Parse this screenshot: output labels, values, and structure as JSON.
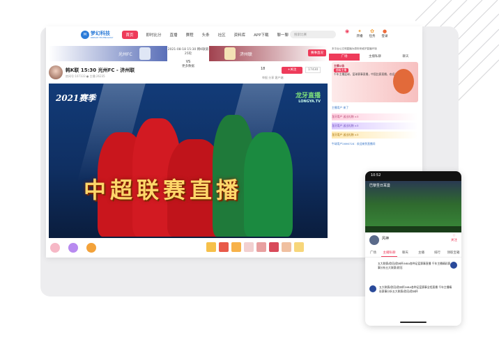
{
  "nav": {
    "logo_text": "梦幻科技",
    "logo_sub": "DREAM TECHNOLOGY",
    "items": [
      "首页",
      "即时比分",
      "直播",
      "赛程",
      "头条",
      "社区",
      "资料库",
      "APP下载",
      "聊一聊"
    ],
    "search_placeholder": "搜索比赛",
    "actions": [
      "开播",
      "任务",
      "登录"
    ]
  },
  "match": {
    "home": "光州FC",
    "away": "济州联",
    "time": "2021-08-18 15:30 韩K联第25轮",
    "more": "更多数据",
    "match_button": "赛事直况"
  },
  "room": {
    "title": "韩K联 15:30 光州FC - 济州联",
    "meta": "房间号:107333   ● 主播:26235",
    "heat": "18",
    "follow": "+关注",
    "fans": "17430",
    "actions": "举报  分享  客户端"
  },
  "video": {
    "season": "2021赛季",
    "brand": "龙牙直播",
    "brand_sub": "LONGYA.TV",
    "headline": "中超联赛直播"
  },
  "chat": {
    "warning": "本平台以文明直播为原则来维护直播环境",
    "tabs": [
      "广场",
      "主播私聊",
      "聊天"
    ],
    "notice_title": "主播公告",
    "notice_tag": "超级主播",
    "notice_text": "千年主播篮球，篮球赛事直播，中国比赛直播，欢迎关注！",
    "rows": [
      "主播用户 来了",
      "龙牙用户 送出礼物 ×3",
      "龙牙用户 送出礼物 ×3",
      "龙牙用户 送出礼物 ×3",
      "牛球用户2696728：欢迎来到直播间"
    ]
  },
  "phone": {
    "time": "10:52",
    "video_title": "巴黎圣日耳曼",
    "anchor": "风神",
    "fav": "关注",
    "tabs": [
      "广场",
      "主播私聊",
      "聊天",
      "主播",
      "排行",
      "领取宝箱"
    ],
    "msg1": "五大联赛/欧冠/欧洲杯/NBA各种足篮赛事直播  千年主播精彩赛事分析五大联赛/欧冠",
    "msg2": "五大联赛/欧冠/欧洲杯/NBA各种足篮赛事全程直播  千年主播精彩赛事分析五大联赛/欧冠/欧洲杯"
  }
}
